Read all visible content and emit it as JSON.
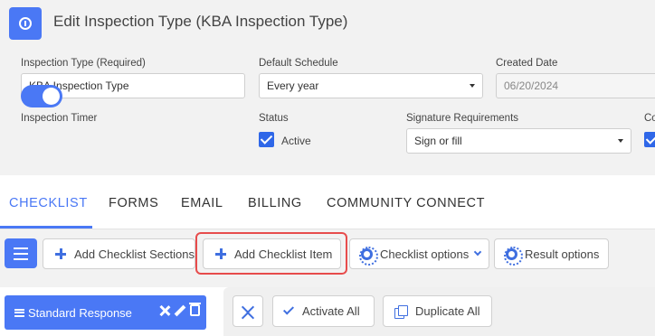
{
  "header": {
    "title": "Edit Inspection Type (KBA Inspection Type)",
    "icon": "power-icon",
    "accent_color": "#4a78f5"
  },
  "form": {
    "inspection_type": {
      "label": "Inspection Type (Required)",
      "value": "KBA Inspection Type"
    },
    "default_schedule": {
      "label": "Default Schedule",
      "value": "Every year"
    },
    "created_date": {
      "label": "Created Date",
      "value": "06/20/2024"
    },
    "inspection_timer": {
      "label": "Inspection Timer",
      "enabled": true
    },
    "status": {
      "label": "Status",
      "checkbox_label": "Active",
      "checked": true
    },
    "signature_requirements": {
      "label": "Signature Requirements",
      "value": "Sign or fill"
    },
    "cut_off_label": "Co"
  },
  "tabs": [
    {
      "label": "CHECKLIST",
      "active": true
    },
    {
      "label": "FORMS",
      "active": false
    },
    {
      "label": "EMAIL",
      "active": false
    },
    {
      "label": "BILLING",
      "active": false
    },
    {
      "label": "COMMUNITY CONNECT",
      "active": false
    }
  ],
  "toolbar": {
    "add_sections": "Add Checklist Sections",
    "add_item": "Add Checklist Item",
    "checklist_options": "Checklist options",
    "result_options": "Result options",
    "highlight_color": "#e74c4c"
  },
  "bottom": {
    "standard_response": "Standard Response",
    "activate_all": "Activate All",
    "duplicate_all": "Duplicate All"
  }
}
